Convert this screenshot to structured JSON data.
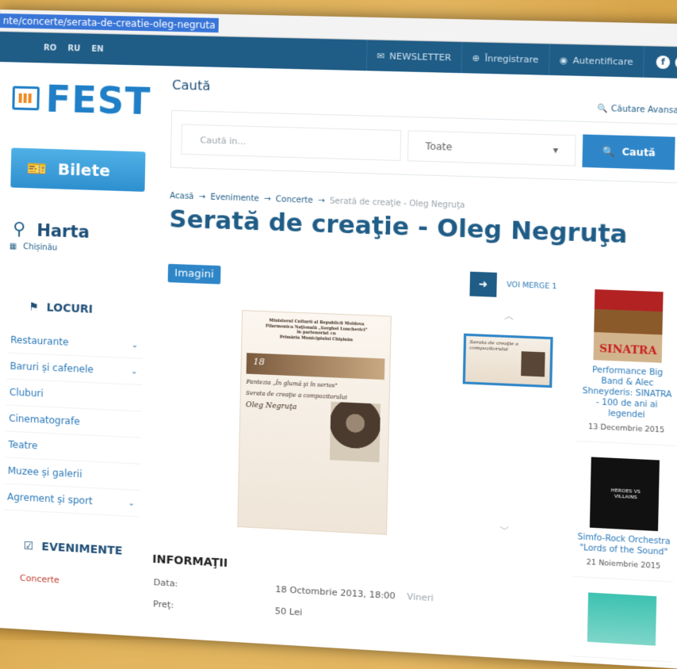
{
  "browser": {
    "url": "nte/concerte/serata-de-creatie-oleg-negruta"
  },
  "topbar": {
    "langs": [
      "RO",
      "RU",
      "EN"
    ],
    "newsletter": "NEWSLETTER",
    "register": "Înregistrare",
    "login": "Autentificare"
  },
  "logo": {
    "text": "FEST"
  },
  "sidebar": {
    "bilete": "Bilete",
    "harta": "Harta",
    "city": "Chișinău",
    "locuri_title": "LOCURI",
    "locuri": [
      {
        "label": "Restaurante",
        "chevron": true
      },
      {
        "label": "Baruri și cafenele",
        "chevron": true
      },
      {
        "label": "Cluburi",
        "chevron": false
      },
      {
        "label": "Cinematografe",
        "chevron": false
      },
      {
        "label": "Teatre",
        "chevron": false
      },
      {
        "label": "Muzee și galerii",
        "chevron": false
      },
      {
        "label": "Agrement și sport",
        "chevron": true
      }
    ],
    "evenimente_title": "EVENIMENTE",
    "evenimente_first": "Concerte"
  },
  "search": {
    "title": "Caută",
    "advanced": "Căutare Avansată",
    "placeholder": "Caută in...",
    "select_value": "Toate",
    "button": "Caută"
  },
  "breadcrumb": [
    "Acasă",
    "Evenimente",
    "Concerte",
    "Serată de creaţie - Oleg Negruţa"
  ],
  "page_title": "Serată de creaţie - Oleg Negruţa",
  "gallery": {
    "tab": "Imagini",
    "voi_merge": "VOI MERGE 1"
  },
  "poster": {
    "header": "Ministerul Culturii al Republicii Moldova\nFilarmonica Naţională „Serghei Lunchevici\"\nîn parteneriat cu\nPrimăria Municipiului Chişinău",
    "band": "18",
    "line1": "Fantezia „În glumă şi în serios\"",
    "line2": "Serata de creaţie a compozitorului",
    "name": "Oleg Negruţa"
  },
  "info": {
    "title": "INFORMAŢII",
    "rows": [
      {
        "k": "Data:",
        "v": "18 Octombrie 2013, 18:00",
        "extra": "Vineri"
      },
      {
        "k": "Preţ:",
        "v": "50 Lei",
        "extra": ""
      }
    ]
  },
  "events": [
    {
      "name": "Performance Big Band & Alec Shneyderis: SINATRA - 100 de ani ai legendei",
      "date": "13 Decembrie 2015"
    },
    {
      "name": "Simfo-Rock Orchestra \"Lords of the Sound\"",
      "date": "21 Noiembrie 2015"
    },
    {
      "name": "",
      "date": ""
    }
  ]
}
